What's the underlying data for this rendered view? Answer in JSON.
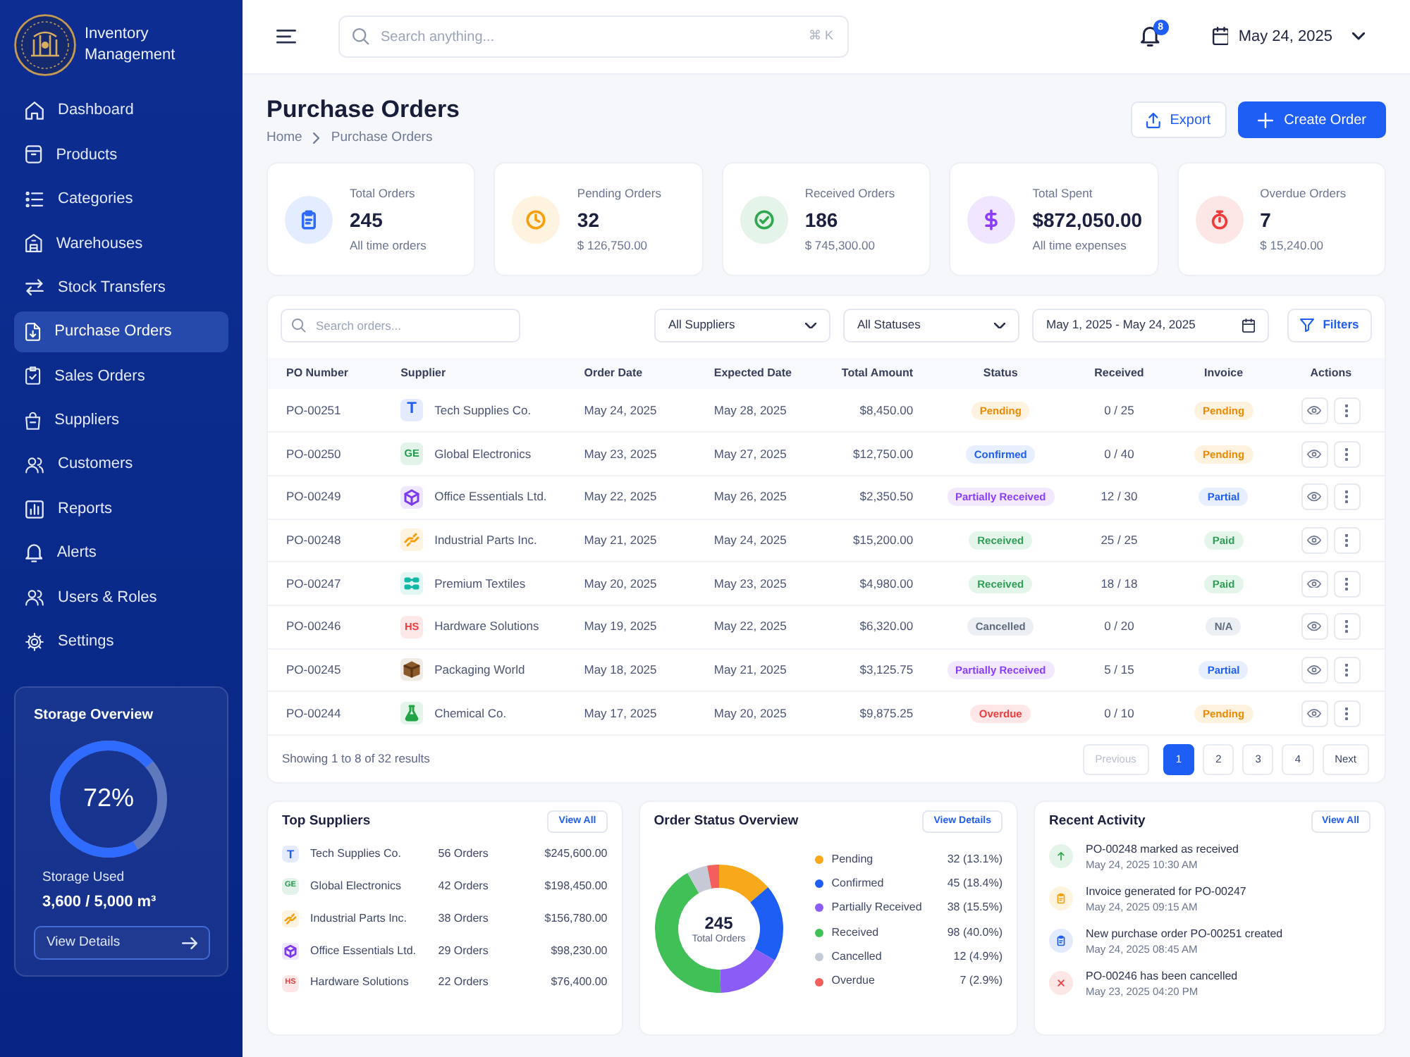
{
  "sidebar": {
    "brand": "Inventory Management",
    "items": [
      {
        "label": "Dashboard",
        "selected": false
      },
      {
        "label": "Products",
        "selected": false
      },
      {
        "label": "Categories",
        "selected": false
      },
      {
        "label": "Warehouses",
        "selected": false
      },
      {
        "label": "Stock Transfers",
        "selected": false
      },
      {
        "label": "Purchase Orders",
        "selected": true
      },
      {
        "label": "Sales Orders",
        "selected": false
      },
      {
        "label": "Suppliers",
        "selected": false
      },
      {
        "label": "Customers",
        "selected": false
      },
      {
        "label": "Reports",
        "selected": false
      },
      {
        "label": "Alerts",
        "selected": false
      },
      {
        "label": "Users & Roles",
        "selected": false
      },
      {
        "label": "Settings",
        "selected": false
      }
    ],
    "storage": {
      "title": "Storage Overview",
      "level": 0.72,
      "percent": "72%",
      "label": "Storage Used",
      "value": "3,600 / 5,000 m³",
      "button": "View Details"
    }
  },
  "header": {
    "search_placeholder": "Search anything...",
    "shortcut": "⌘ K",
    "notification_count": "8",
    "date": "May 24, 2025"
  },
  "page": {
    "title": "Purchase Orders",
    "breadcrumb": [
      "Home",
      "Purchase Orders"
    ],
    "actions": [
      {
        "label": "Export",
        "kind": "secondary"
      },
      {
        "label": "Create Order",
        "kind": "primary"
      }
    ]
  },
  "stats": [
    {
      "label": "Total Orders",
      "value": "245",
      "note": "All time orders",
      "kind": "total",
      "color": "#2f6bff"
    },
    {
      "label": "Pending Orders",
      "value": "32",
      "note": "$ 126,750.00",
      "kind": "pending",
      "color": "#f59f0b"
    },
    {
      "label": "Received Orders",
      "value": "186",
      "note": "$ 745,300.00",
      "kind": "received",
      "color": "#2fa84f"
    },
    {
      "label": "Total Spent",
      "value": "$872,050.00",
      "note": "All time expenses",
      "kind": "spent",
      "color": "#8b3dff"
    },
    {
      "label": "Overdue Orders",
      "value": "7",
      "note": "$ 15,240.00",
      "kind": "overdue",
      "color": "#ef3b3b"
    }
  ],
  "orders": {
    "search_placeholder": "Search orders...",
    "filters": [
      "All Suppliers",
      "All Statuses"
    ],
    "date_range": "May 1, 2025 - May 24, 2025",
    "filter_button": "Filters",
    "columns": [
      "PO Number",
      "Supplier",
      "Order Date",
      "Expected Date",
      "Total Amount",
      "Status",
      "Received",
      "Invoice",
      "Actions"
    ],
    "rows": [
      {
        "po": "PO-00251",
        "supplier": {
          "name": "Tech Supplies Co.",
          "kind": "letters",
          "logo_text": "T",
          "color": "#1f5ef5"
        },
        "order_date": "May 24, 2025",
        "expected_date": "May 28, 2025",
        "total": "$8,450.00",
        "status": {
          "text": "Pending",
          "kind": "pending"
        },
        "received": "0 / 25",
        "invoice": {
          "text": "Pending",
          "kind": "pending"
        }
      },
      {
        "po": "PO-00250",
        "supplier": {
          "name": "Global Electronics",
          "kind": "letters",
          "logo_text": "GE",
          "color": "#1f9d4c"
        },
        "order_date": "May 23, 2025",
        "expected_date": "May 27, 2025",
        "total": "$12,750.00",
        "status": {
          "text": "Confirmed",
          "kind": "confirmed"
        },
        "received": "0 / 40",
        "invoice": {
          "text": "Pending",
          "kind": "pending"
        }
      },
      {
        "po": "PO-00249",
        "supplier": {
          "name": "Office Essentials Ltd.",
          "kind": "cube",
          "color": "#7c3aed"
        },
        "order_date": "May 22, 2025",
        "expected_date": "May 26, 2025",
        "total": "$2,350.50",
        "status": {
          "text": "Partially Received",
          "kind": "partial"
        },
        "received": "12 / 30",
        "invoice": {
          "text": "Partial",
          "kind": "partial"
        }
      },
      {
        "po": "PO-00248",
        "supplier": {
          "name": "Industrial Parts Inc.",
          "kind": "link",
          "color": "#f59f0b"
        },
        "order_date": "May 21, 2025",
        "expected_date": "May 24, 2025",
        "total": "$15,200.00",
        "status": {
          "text": "Received",
          "kind": "received"
        },
        "received": "25 / 25",
        "invoice": {
          "text": "Paid",
          "kind": "paid"
        }
      },
      {
        "po": "PO-00247",
        "supplier": {
          "name": "Premium Textiles",
          "kind": "grid",
          "color": "#14b8a6"
        },
        "order_date": "May 20, 2025",
        "expected_date": "May 23, 2025",
        "total": "$4,980.00",
        "status": {
          "text": "Received",
          "kind": "received"
        },
        "received": "18 / 18",
        "invoice": {
          "text": "Paid",
          "kind": "paid"
        }
      },
      {
        "po": "PO-00246",
        "supplier": {
          "name": "Hardware Solutions",
          "kind": "letters",
          "logo_text": "HS",
          "color": "#ef3b3b"
        },
        "order_date": "May 19, 2025",
        "expected_date": "May 22, 2025",
        "total": "$6,320.00",
        "status": {
          "text": "Cancelled",
          "kind": "cancelled"
        },
        "received": "0 / 20",
        "invoice": {
          "text": "N/A",
          "kind": "none"
        }
      },
      {
        "po": "PO-00245",
        "supplier": {
          "name": "Packaging World",
          "kind": "package",
          "color": "#8b5a2b"
        },
        "order_date": "May 18, 2025",
        "expected_date": "May 21, 2025",
        "total": "$3,125.75",
        "status": {
          "text": "Partially Received",
          "kind": "partial"
        },
        "received": "5 / 15",
        "invoice": {
          "text": "Partial",
          "kind": "partial"
        }
      },
      {
        "po": "PO-00244",
        "supplier": {
          "name": "Chemical Co.",
          "kind": "flask",
          "color": "#22a447"
        },
        "order_date": "May 17, 2025",
        "expected_date": "May 20, 2025",
        "total": "$9,875.25",
        "status": {
          "text": "Overdue",
          "kind": "overdue"
        },
        "received": "0 / 10",
        "invoice": {
          "text": "Pending",
          "kind": "pending"
        }
      }
    ],
    "summary": "Showing 1 to 8 of 32 results",
    "pagination": {
      "previous": {
        "label": "Previous",
        "disabled": true
      },
      "pages": [
        {
          "label": "1",
          "selected": true
        },
        {
          "label": "2",
          "selected": false
        },
        {
          "label": "3",
          "selected": false
        },
        {
          "label": "4",
          "selected": false
        }
      ],
      "next": {
        "label": "Next",
        "disabled": false
      }
    }
  },
  "top_suppliers": {
    "title": "Top Suppliers",
    "button": "View All",
    "items": [
      {
        "name": "Tech Supplies Co.",
        "kind": "letters",
        "logo_text": "T",
        "color": "#1f5ef5",
        "orders": "56 Orders",
        "amount": "$245,600.00"
      },
      {
        "name": "Global Electronics",
        "kind": "letters",
        "logo_text": "GE",
        "color": "#1f9d4c",
        "orders": "42 Orders",
        "amount": "$198,450.00"
      },
      {
        "name": "Industrial Parts Inc.",
        "kind": "link",
        "color": "#f59f0b",
        "orders": "38 Orders",
        "amount": "$156,780.00"
      },
      {
        "name": "Office Essentials Ltd.",
        "kind": "cube",
        "color": "#7c3aed",
        "orders": "29 Orders",
        "amount": "$98,230.00"
      },
      {
        "name": "Hardware Solutions",
        "kind": "letters",
        "logo_text": "HS",
        "color": "#ef3b3b",
        "orders": "22 Orders",
        "amount": "$76,400.00"
      }
    ]
  },
  "order_status": {
    "title": "Order Status Overview",
    "button": "View Details",
    "center_value": "245",
    "center_label": "Total Orders",
    "chart_data": {
      "type": "donut",
      "categories": [
        "Pending",
        "Confirmed",
        "Partially Received",
        "Received",
        "Cancelled",
        "Overdue"
      ],
      "values": [
        13.8,
        19.4,
        16.4,
        42.2,
        5.2,
        3.0
      ]
    },
    "legend": [
      {
        "reading": "32 (13.1%)",
        "color": "#f7a81b"
      },
      {
        "reading": "45 (18.4%)",
        "color": "#1f5ef5"
      },
      {
        "reading": "38 (15.5%)",
        "color": "#8b5cf6"
      },
      {
        "reading": "98 (40.0%)",
        "color": "#40c057"
      },
      {
        "reading": "12 (4.9%)",
        "color": "#c5cad6"
      },
      {
        "reading": "7 (2.9%)",
        "color": "#f25f5c"
      }
    ]
  },
  "recent_activity": {
    "title": "Recent Activity",
    "button": "View All",
    "items": [
      {
        "text": "PO-00248 marked as received",
        "time": "May 24, 2025 10:30 AM",
        "kind": "received"
      },
      {
        "text": "Invoice generated for PO-00247",
        "time": "May 24, 2025 09:15 AM",
        "kind": "invoice"
      },
      {
        "text": "New purchase order PO-00251 created",
        "time": "May 24, 2025 08:45 AM",
        "kind": "created"
      },
      {
        "text": "PO-00246 has been cancelled",
        "time": "May 23, 2025 04:20 PM",
        "kind": "cancelled"
      }
    ]
  }
}
